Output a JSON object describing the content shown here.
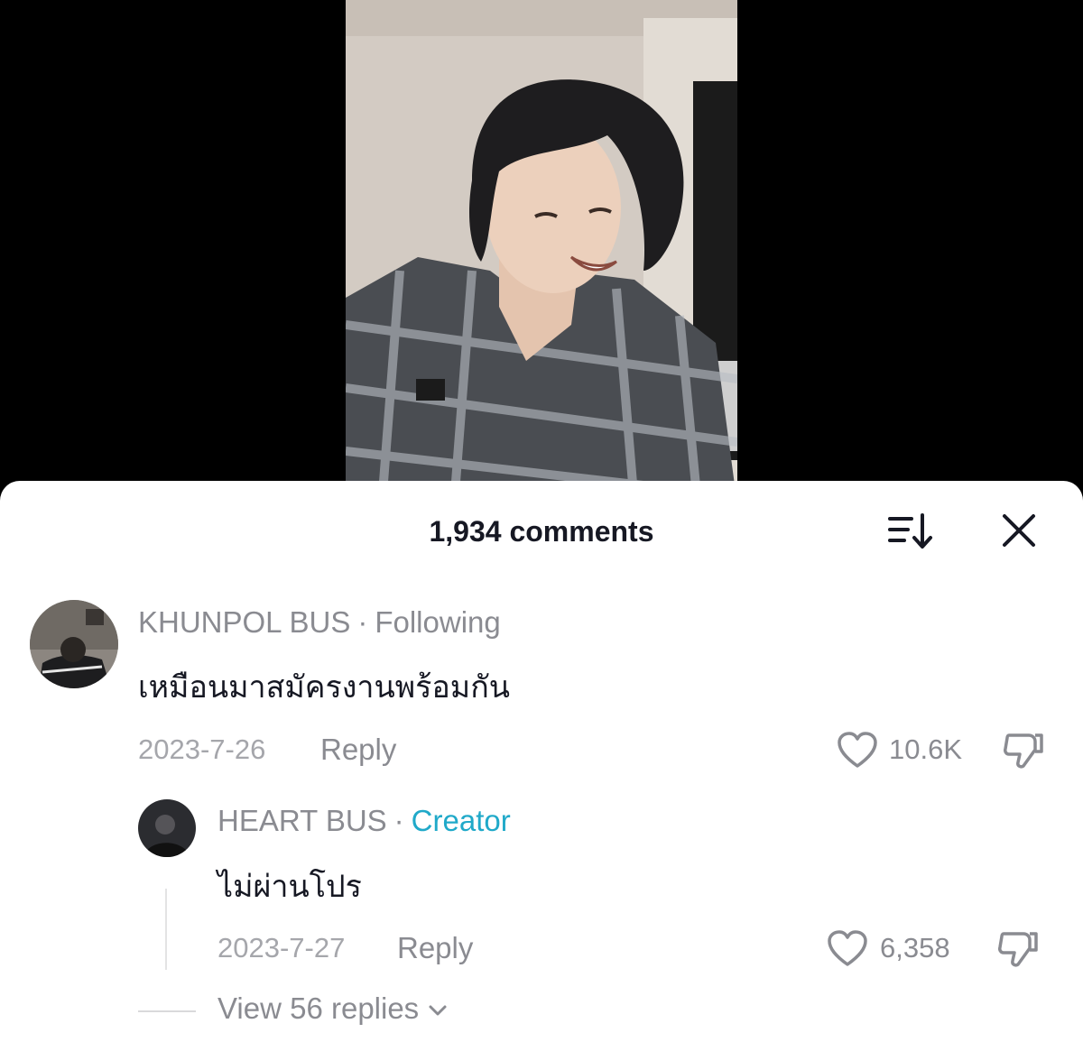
{
  "sheet": {
    "title": "1,934 comments",
    "sort_icon": "sort-descending-icon",
    "close_icon": "close-icon"
  },
  "comments": [
    {
      "author": "KHUNPOL BUS",
      "separator": "·",
      "badge": "Following",
      "text": "เหมือนมาสมัครงานพร้อมกัน",
      "date": "2023-7-26",
      "reply_label": "Reply",
      "likes": "10.6K"
    }
  ],
  "replies": [
    {
      "author": "HEART BUS",
      "separator": "·",
      "badge": "Creator",
      "badge_color": "#20a9c9",
      "text": "ไม่ผ่านโปร",
      "date": "2023-7-27",
      "reply_label": "Reply",
      "likes": "6,358"
    }
  ],
  "view_replies": "View 56 replies",
  "colors": {
    "text_primary": "#161823",
    "text_secondary": "#8a8b91",
    "creator_badge": "#20a9c9"
  }
}
